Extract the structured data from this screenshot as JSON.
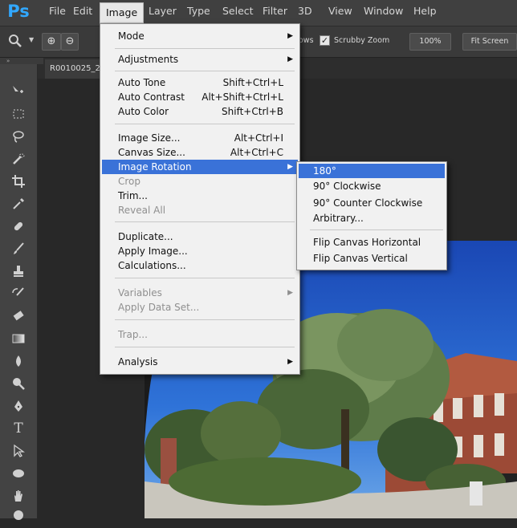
{
  "app": {
    "logo": "Ps"
  },
  "menubar": {
    "items": [
      {
        "label": "File"
      },
      {
        "label": "Edit"
      },
      {
        "label": "Image"
      },
      {
        "label": "Layer"
      },
      {
        "label": "Type"
      },
      {
        "label": "Select"
      },
      {
        "label": "Filter"
      },
      {
        "label": "3D"
      },
      {
        "label": "View"
      },
      {
        "label": "Window"
      },
      {
        "label": "Help"
      }
    ]
  },
  "options": {
    "partial_label": "ows",
    "scrubby_zoom_label": "Scrubby Zoom",
    "scrubby_zoom_checked": true,
    "zoom_percent": "100%",
    "fit_screen": "Fit Screen"
  },
  "document": {
    "tab_title": "R0010025_2"
  },
  "image_menu": {
    "items": [
      {
        "label": "Mode",
        "submenu": true
      },
      {
        "label": "Adjustments",
        "submenu": true
      },
      {
        "label": "Auto Tone",
        "shortcut": "Shift+Ctrl+L"
      },
      {
        "label": "Auto Contrast",
        "shortcut": "Alt+Shift+Ctrl+L"
      },
      {
        "label": "Auto Color",
        "shortcut": "Shift+Ctrl+B"
      },
      {
        "label": "Image Size...",
        "shortcut": "Alt+Ctrl+I"
      },
      {
        "label": "Canvas Size...",
        "shortcut": "Alt+Ctrl+C"
      },
      {
        "label": "Image Rotation",
        "submenu": true,
        "highlighted": true
      },
      {
        "label": "Crop",
        "disabled": true
      },
      {
        "label": "Trim..."
      },
      {
        "label": "Reveal All",
        "disabled": true
      },
      {
        "label": "Duplicate..."
      },
      {
        "label": "Apply Image..."
      },
      {
        "label": "Calculations..."
      },
      {
        "label": "Variables",
        "submenu": true,
        "disabled": true
      },
      {
        "label": "Apply Data Set...",
        "disabled": true
      },
      {
        "label": "Trap...",
        "disabled": true
      },
      {
        "label": "Analysis",
        "submenu": true
      }
    ]
  },
  "rotation_submenu": {
    "items": [
      {
        "label": "180°",
        "highlighted": true
      },
      {
        "label": "90° Clockwise"
      },
      {
        "label": "90° Counter Clockwise"
      },
      {
        "label": "Arbitrary..."
      },
      {
        "label": "Flip Canvas Horizontal"
      },
      {
        "label": "Flip Canvas Vertical"
      }
    ]
  },
  "colors": {
    "highlight": "#3a72d8",
    "ps_logo": "#31a8ff",
    "sky": "#1c53c9"
  }
}
